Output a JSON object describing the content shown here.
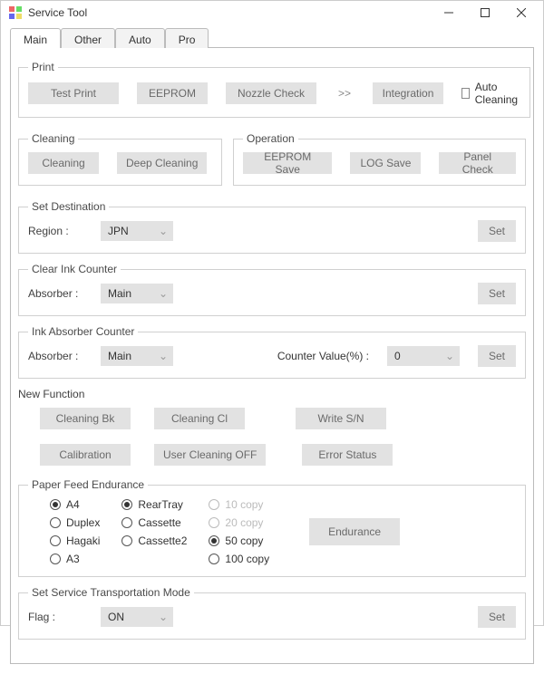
{
  "window": {
    "title": "Service Tool"
  },
  "tabs": [
    "Main",
    "Other",
    "Auto",
    "Pro"
  ],
  "print": {
    "legend": "Print",
    "test_print": "Test Print",
    "eeprom": "EEPROM",
    "nozzle_check": "Nozzle Check",
    "arrow": ">>",
    "integration": "Integration",
    "auto_cleaning": "Auto Cleaning"
  },
  "cleaning": {
    "legend": "Cleaning",
    "cleaning": "Cleaning",
    "deep_cleaning": "Deep Cleaning"
  },
  "operation": {
    "legend": "Operation",
    "eeprom_save": "EEPROM Save",
    "log_save": "LOG Save",
    "panel_check": "Panel Check"
  },
  "set_dest": {
    "legend": "Set Destination",
    "region_label": "Region :",
    "region_value": "JPN",
    "set": "Set"
  },
  "clear_ink": {
    "legend": "Clear Ink Counter",
    "absorber_label": "Absorber :",
    "absorber_value": "Main",
    "set": "Set"
  },
  "ink_abs": {
    "legend": "Ink Absorber Counter",
    "absorber_label": "Absorber :",
    "absorber_value": "Main",
    "counter_label": "Counter Value(%) :",
    "counter_value": "0",
    "set": "Set"
  },
  "new_func": {
    "title": "New Function",
    "cleaning_bk": "Cleaning Bk",
    "cleaning_cl": "Cleaning Cl",
    "write_sn": "Write S/N",
    "calibration": "Calibration",
    "user_cleaning_off": "User Cleaning OFF",
    "error_status": "Error Status"
  },
  "paper_feed": {
    "legend": "Paper Feed Endurance",
    "size": {
      "options": [
        "A4",
        "Duplex",
        "Hagaki",
        "A3"
      ],
      "selected": "A4"
    },
    "tray": {
      "options": [
        "RearTray",
        "Cassette",
        "Cassette2"
      ],
      "selected": "RearTray"
    },
    "copies": {
      "options": [
        "10 copy",
        "20 copy",
        "50 copy",
        "100 copy"
      ],
      "selected": "50 copy"
    },
    "endurance": "Endurance"
  },
  "transport": {
    "legend": "Set Service Transportation Mode",
    "flag_label": "Flag :",
    "flag_value": "ON",
    "set": "Set"
  }
}
